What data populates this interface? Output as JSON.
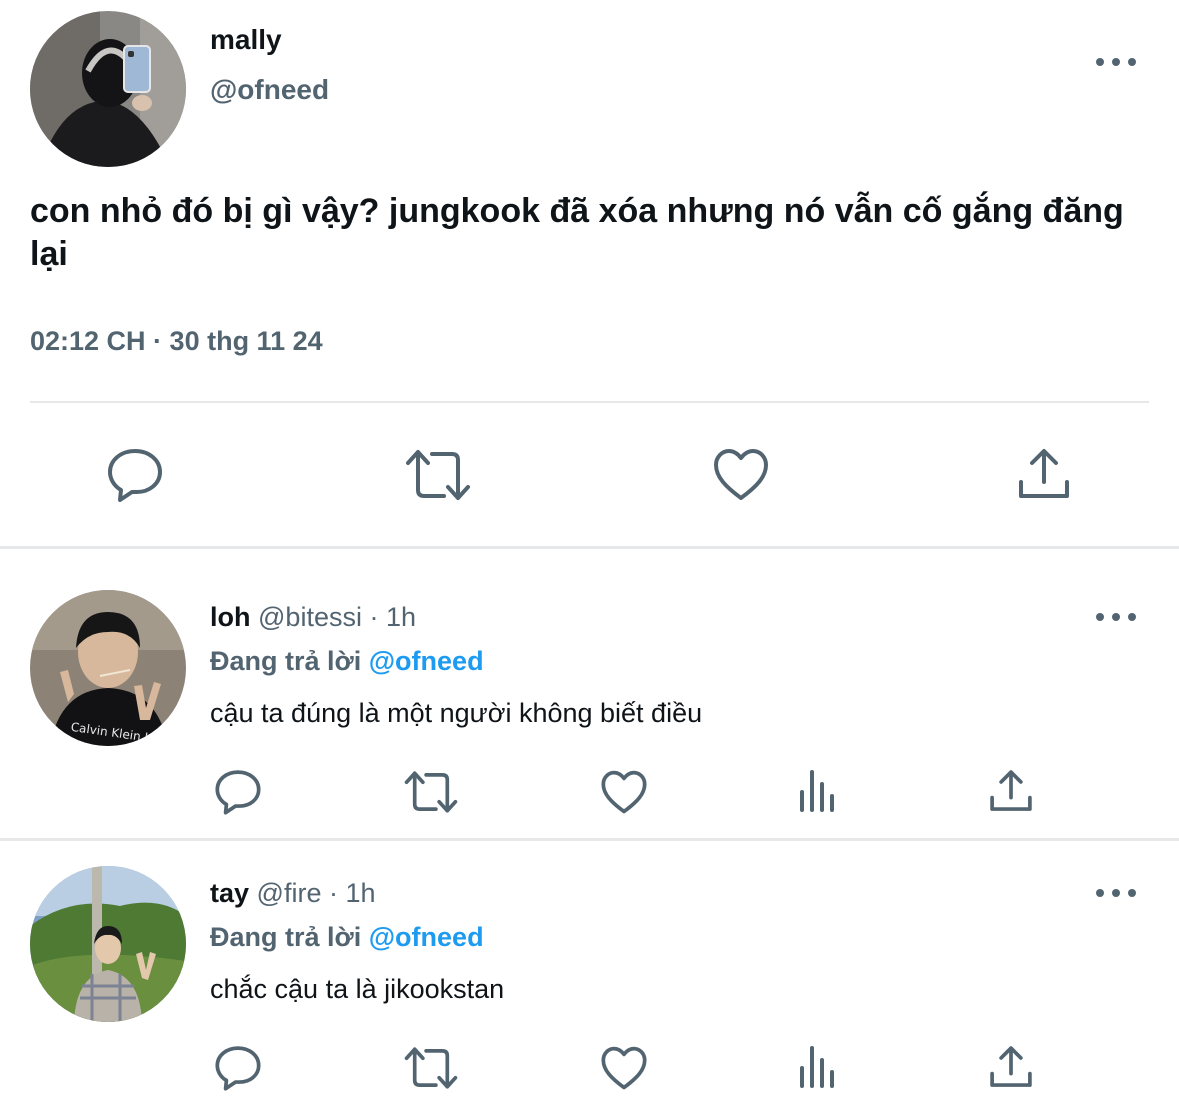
{
  "main_tweet": {
    "author_name": "mally",
    "author_handle": "@ofneed",
    "text": "con nhỏ đó bị gì vậy? jungkook đã xóa nhưng nó vẫn cố gắng đăng lại",
    "timestamp": "02:12 CH · 30 thg 11 24",
    "actions": [
      "reply-icon",
      "retweet-icon",
      "like-icon",
      "share-icon"
    ]
  },
  "replies": [
    {
      "author_name": "loh",
      "author_handle": "@bitessi",
      "separator": "·",
      "time": "1h",
      "replying_label": "Đang trả lời",
      "replying_to": "@ofneed",
      "text": "cậu ta đúng là một người không biết điều",
      "avatar_print": "Calvin Klein Jea"
    },
    {
      "author_name": "tay",
      "author_handle": "@fire",
      "separator": "·",
      "time": "1h",
      "replying_label": "Đang trả lời",
      "replying_to": "@ofneed",
      "text": "chắc cậu ta là jikookstan"
    }
  ],
  "colors": {
    "text": "#0f1419",
    "secondary": "#536471",
    "mention": "#1d9bf0",
    "divider": "#e6e8ea"
  }
}
